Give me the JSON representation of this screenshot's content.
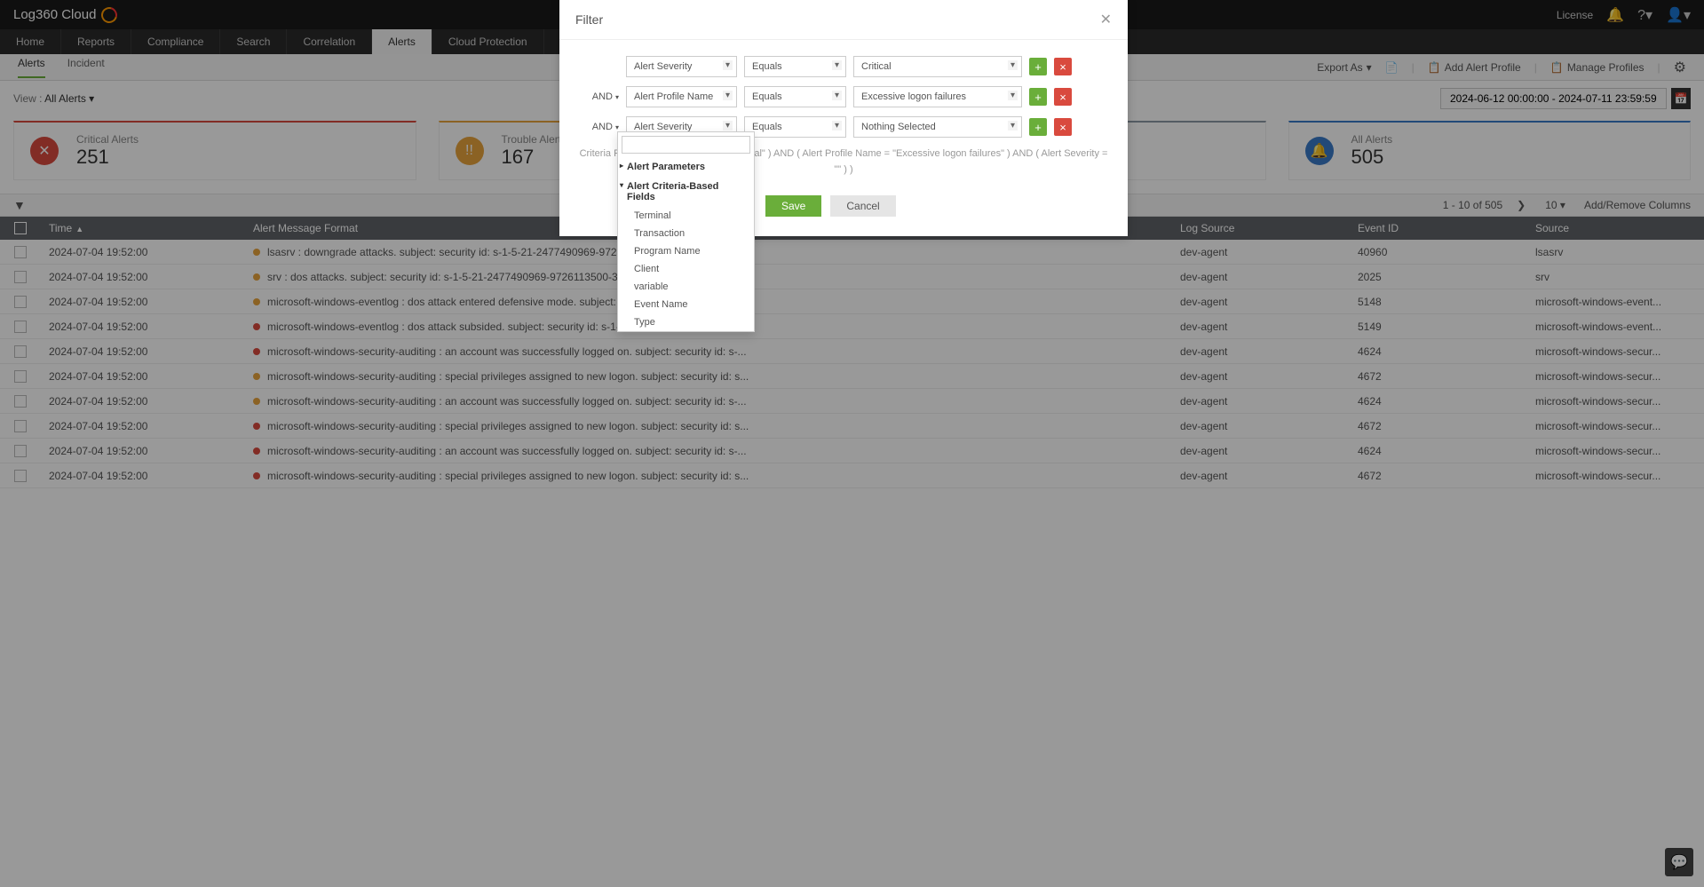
{
  "brand": "Log360 Cloud",
  "topbar": {
    "license": "License"
  },
  "nav": {
    "items": [
      "Home",
      "Reports",
      "Compliance",
      "Search",
      "Correlation",
      "Alerts",
      "Cloud Protection"
    ]
  },
  "subnav": {
    "items": [
      "Alerts",
      "Incident"
    ],
    "export": "Export As",
    "addProfile": "Add Alert Profile",
    "manageProfiles": "Manage Profiles"
  },
  "view": {
    "label": "View :",
    "value": "All Alerts",
    "date": "2024-06-12 00:00:00 - 2024-07-11 23:59:59"
  },
  "cards": {
    "critical": {
      "label": "Critical Alerts",
      "count": "251"
    },
    "trouble": {
      "label": "Trouble Alerts",
      "count": "167"
    },
    "all": {
      "label": "All Alerts",
      "count": "505"
    }
  },
  "tablebar": {
    "range": "1 - 10 of 505",
    "pageSize": "10",
    "addRemove": "Add/Remove Columns"
  },
  "columns": {
    "time": "Time",
    "msg": "Alert Message Format",
    "log": "Log Source",
    "evt": "Event ID",
    "src": "Source"
  },
  "rows": [
    {
      "time": "2024-07-04 19:52:00",
      "sev": "orange",
      "msg": "lsasrv : downgrade attacks. subject: security id: s-1-5-21-2477490969-9726113500...",
      "log": "dev-agent",
      "evt": "40960",
      "src": "lsasrv"
    },
    {
      "time": "2024-07-04 19:52:00",
      "sev": "orange",
      "msg": "srv : dos attacks. subject: security id: s-1-5-21-2477490969-9726113500-346148...",
      "log": "dev-agent",
      "evt": "2025",
      "src": "srv"
    },
    {
      "time": "2024-07-04 19:52:00",
      "sev": "orange",
      "msg": "microsoft-windows-eventlog : dos attack entered defensive mode. subject: security id: s-1-5-21-247...",
      "log": "dev-agent",
      "evt": "5148",
      "src": "microsoft-windows-event..."
    },
    {
      "time": "2024-07-04 19:52:00",
      "sev": "red",
      "msg": "microsoft-windows-eventlog : dos attack subsided. subject: security id: s-1-5-21-2477490969-97261...",
      "log": "dev-agent",
      "evt": "5149",
      "src": "microsoft-windows-event..."
    },
    {
      "time": "2024-07-04 19:52:00",
      "sev": "red",
      "msg": "microsoft-windows-security-auditing : an account was successfully logged on. subject: security id: s-...",
      "log": "dev-agent",
      "evt": "4624",
      "src": "microsoft-windows-secur..."
    },
    {
      "time": "2024-07-04 19:52:00",
      "sev": "orange",
      "msg": "microsoft-windows-security-auditing : special privileges assigned to new logon. subject: security id: s...",
      "log": "dev-agent",
      "evt": "4672",
      "src": "microsoft-windows-secur..."
    },
    {
      "time": "2024-07-04 19:52:00",
      "sev": "orange",
      "msg": "microsoft-windows-security-auditing : an account was successfully logged on. subject: security id: s-...",
      "log": "dev-agent",
      "evt": "4624",
      "src": "microsoft-windows-secur..."
    },
    {
      "time": "2024-07-04 19:52:00",
      "sev": "red",
      "msg": "microsoft-windows-security-auditing : special privileges assigned to new logon. subject: security id: s...",
      "log": "dev-agent",
      "evt": "4672",
      "src": "microsoft-windows-secur..."
    },
    {
      "time": "2024-07-04 19:52:00",
      "sev": "red",
      "msg": "microsoft-windows-security-auditing : an account was successfully logged on. subject: security id: s-...",
      "log": "dev-agent",
      "evt": "4624",
      "src": "microsoft-windows-secur..."
    },
    {
      "time": "2024-07-04 19:52:00",
      "sev": "red",
      "msg": "microsoft-windows-security-auditing : special privileges assigned to new logon. subject: security id: s...",
      "log": "dev-agent",
      "evt": "4672",
      "src": "microsoft-windows-secur..."
    }
  ],
  "dialog": {
    "title": "Filter",
    "logic": "AND",
    "rows": [
      {
        "field": "Alert Severity",
        "op": "Equals",
        "val": "Critical"
      },
      {
        "field": "Alert Profile Name",
        "op": "Equals",
        "val": "Excessive logon failures"
      },
      {
        "field": "Alert Severity",
        "op": "Equals",
        "val": "Nothing Selected"
      }
    ],
    "criteriaLabel": "Criteria Pattern",
    "criteria": "( ( Alert Severity = \"Critical\" ) AND ( Alert Profile Name = \"Excessive logon failures\" ) AND ( Alert Severity = \"\" ) )",
    "save": "Save",
    "cancel": "Cancel"
  },
  "dropdown": {
    "group1": "Alert Parameters",
    "group2": "Alert Criteria-Based Fields",
    "items": [
      "Terminal",
      "Transaction",
      "Program Name",
      "Client",
      "variable",
      "Event Name",
      "Type"
    ]
  }
}
